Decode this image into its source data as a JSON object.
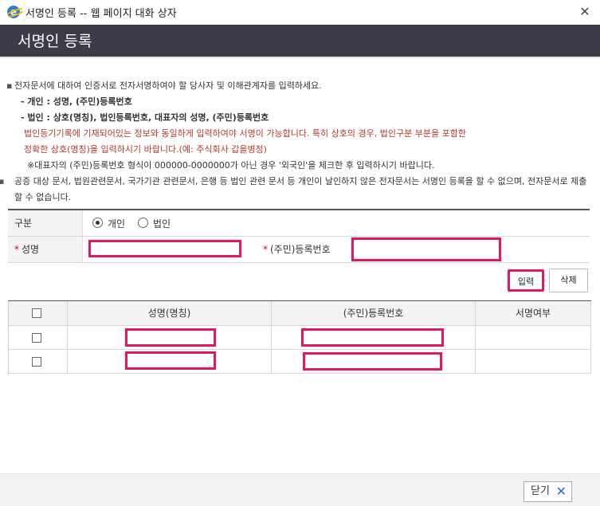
{
  "window": {
    "title": "서명인 등록 -- 웹 페이지 대화 상자",
    "close_glyph": "✕"
  },
  "header": {
    "title": "서명인 등록"
  },
  "notes": {
    "line1": "전자문서에 대하여 인증서로 전자서명하여야 할 당사자 및 이해관계자를 입력하세요.",
    "individual": "- 개인 : 성명, (주민)등록번호",
    "corporate": "- 법인 : 상호(명칭), 법인등록번호, 대표자의 성명, (주민)등록번호",
    "warn1": "법인등기기록에 기재되어있는 정보와 동일하게 입력하여야 서명이 가능합니다. 특히 상호의 경우, 법인구분 부분을 포함한",
    "warn2": "정확한 상호(명칭)을 입력하시기 바랍니다.(예: 주식회사 갑을병정)",
    "ref": "※대표자의 (주민)등록번호 형식이 000000-0000000가 아닌 경우 '외국인'을 체크한 후 입력하시기 바랍니다.",
    "line2": "공증 대상 문서, 법원관련문서, 국가기관 관련문서, 은행 등 법인 관련 문서 등 개인이 날인하지 않은 전자문서는 서명인 등록을 할 수 없으며, 전자문서로 제출 할 수 없습니다."
  },
  "form": {
    "type_label": "구분",
    "opt_individual": "개인",
    "opt_corporate": "법인",
    "selected": "개인",
    "name_label": "성명",
    "reg_label": "(주민)등록번호",
    "name_value": "",
    "reg_value": ""
  },
  "buttons": {
    "add": "입력",
    "delete": "삭제",
    "close": "닫기"
  },
  "grid": {
    "columns": [
      "",
      "성명(명칭)",
      "(주민)등록번호",
      "서명여부"
    ],
    "rows": [
      {
        "name": "",
        "reg": "",
        "signed": ""
      },
      {
        "name": "",
        "reg": "",
        "signed": ""
      }
    ]
  },
  "colors": {
    "header_band": "#3c3b47",
    "highlight": "#e5175a",
    "warning_text": "#b03a2e"
  }
}
